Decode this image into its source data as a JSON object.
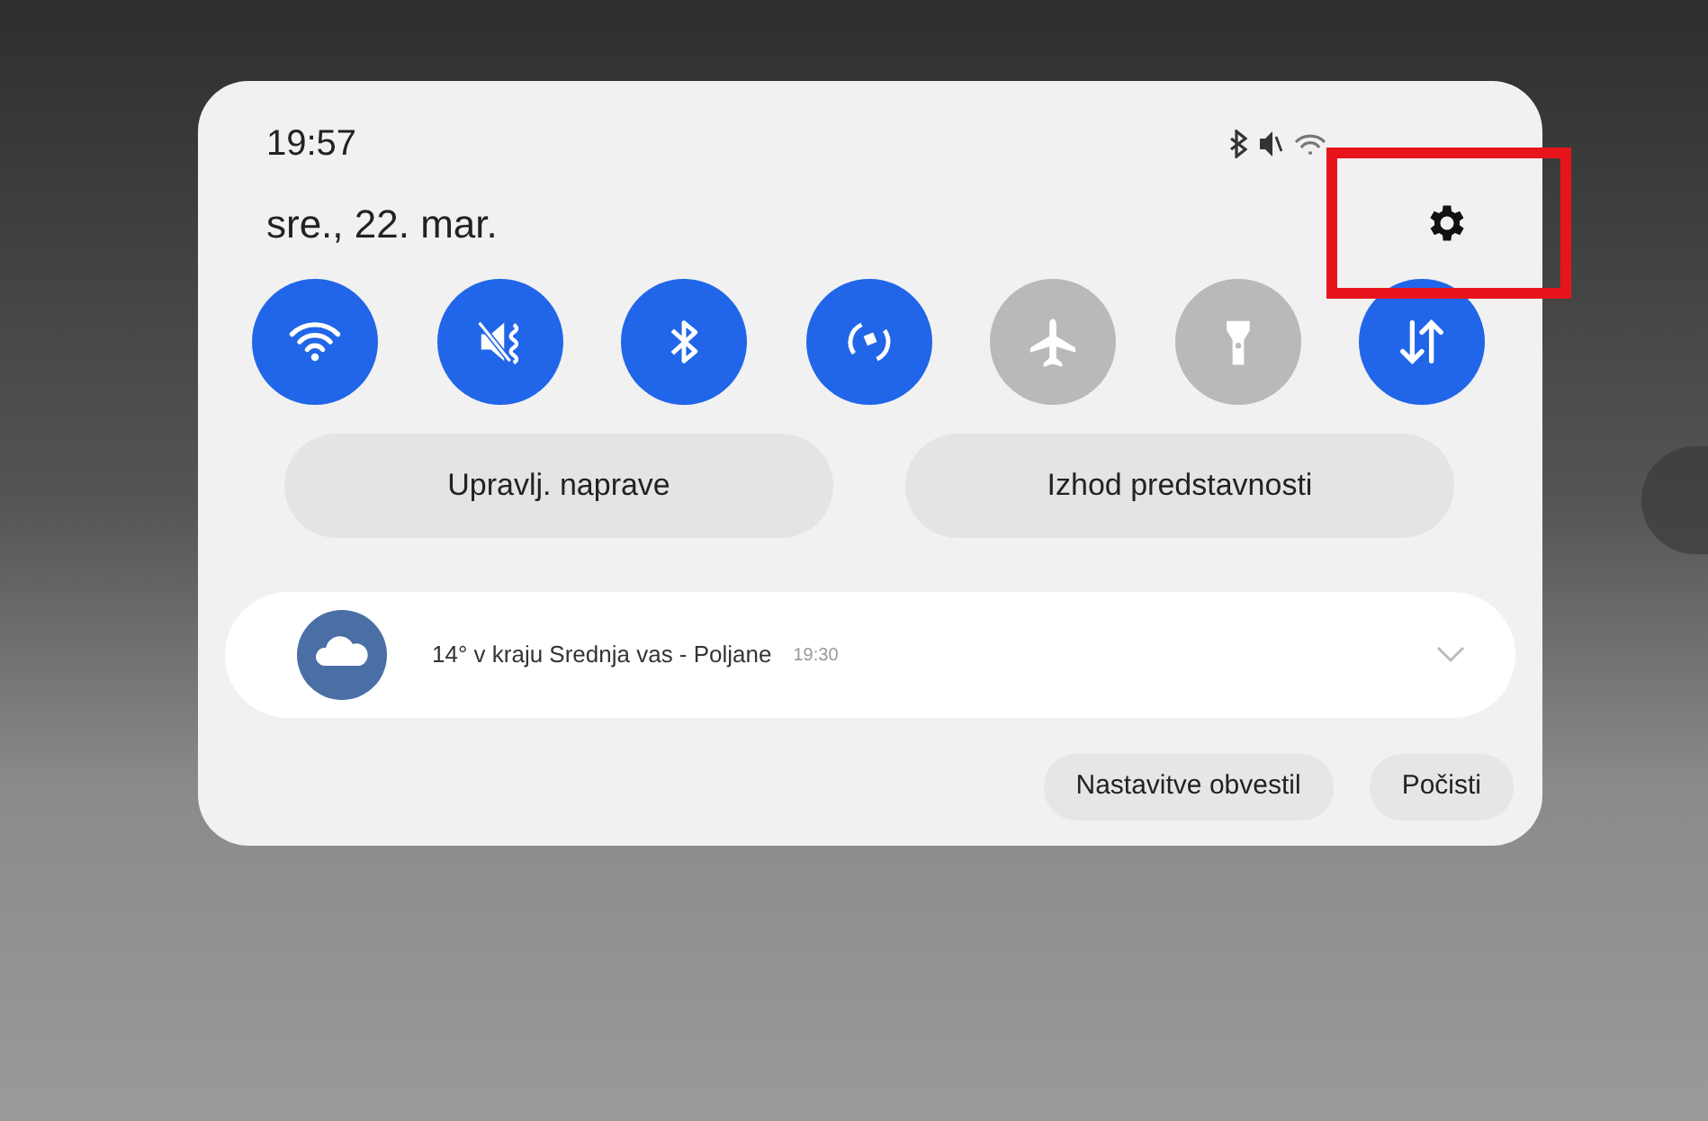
{
  "status_bar": {
    "time": "19:57"
  },
  "date": "sre., 22. mar.",
  "quick_tiles": [
    {
      "kind": "wifi",
      "on": true
    },
    {
      "kind": "mute",
      "on": true
    },
    {
      "kind": "bluetooth",
      "on": true
    },
    {
      "kind": "rotate",
      "on": true
    },
    {
      "kind": "airplane",
      "on": false
    },
    {
      "kind": "flashlight",
      "on": false
    },
    {
      "kind": "data",
      "on": true
    }
  ],
  "shortcut_buttons": [
    "Upravlj. naprave",
    "Izhod predstavnosti"
  ],
  "notification": {
    "text": "14° v kraju Srednja vas - Poljane",
    "time": "19:30"
  },
  "notification_actions": [
    "Nastavitve obvestil",
    "Počisti"
  ]
}
